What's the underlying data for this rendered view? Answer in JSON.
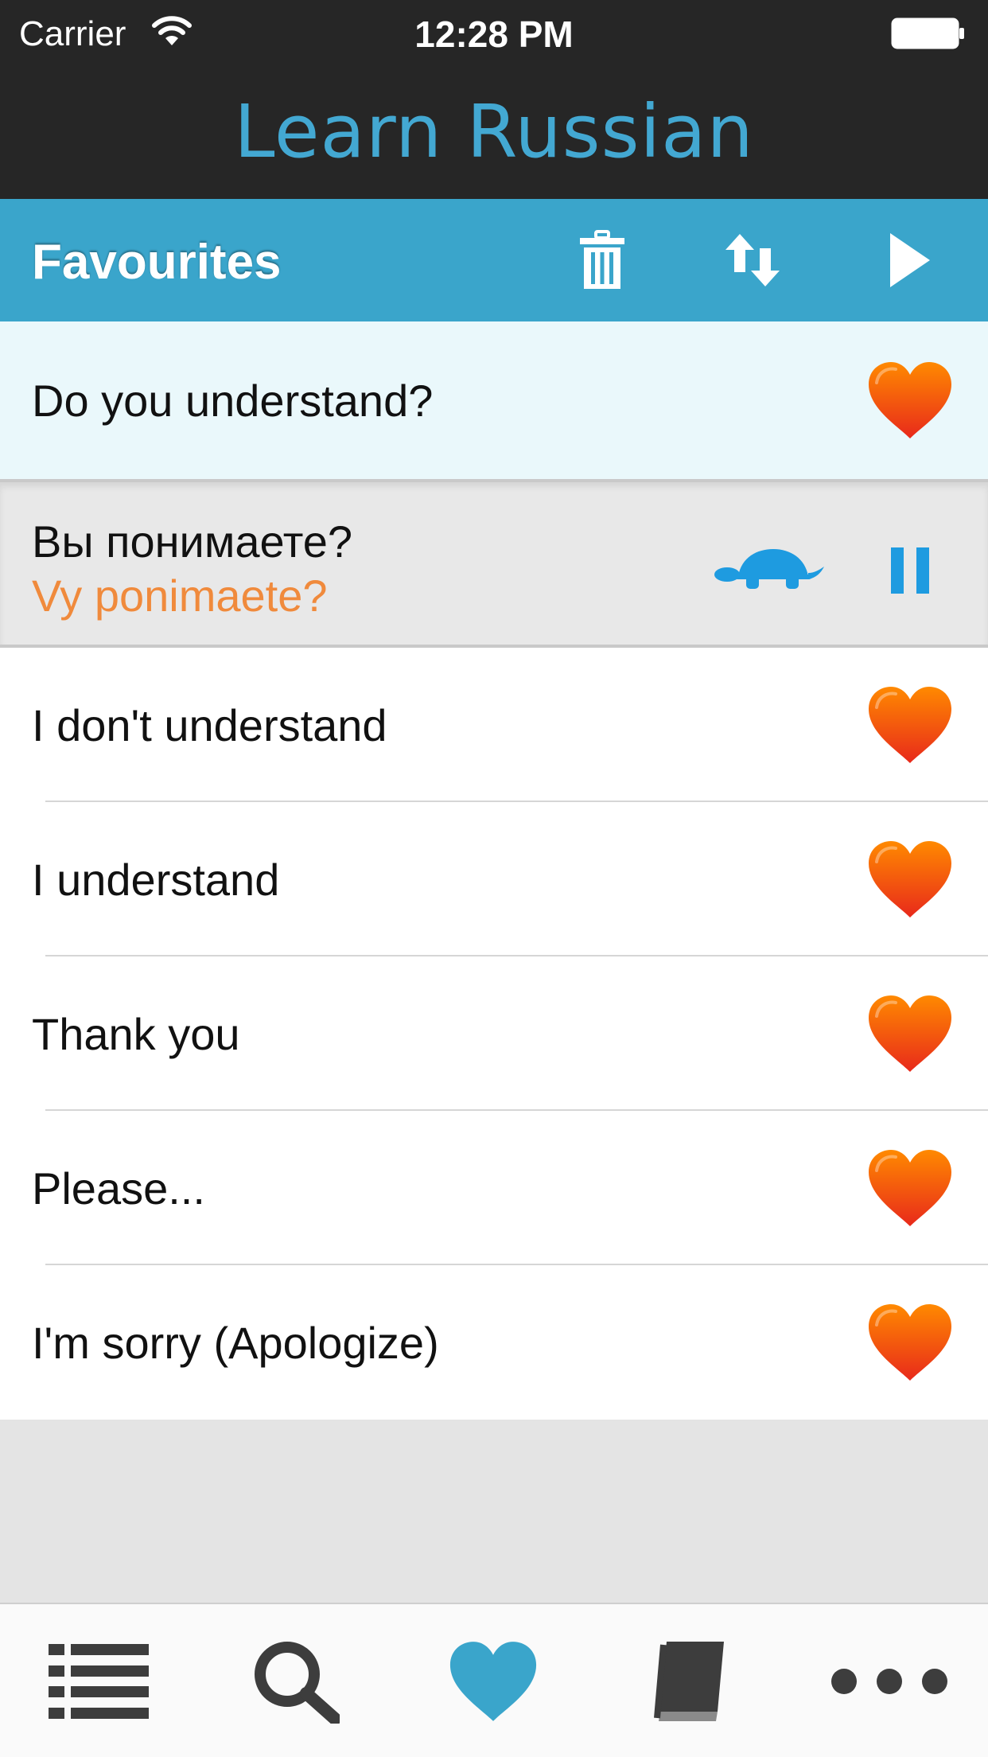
{
  "status_bar": {
    "carrier": "Carrier",
    "time": "12:28 PM"
  },
  "nav": {
    "title": "Learn Russian"
  },
  "section": {
    "label": "Favourites",
    "actions": [
      "trash-icon",
      "sort-icon",
      "play-icon"
    ]
  },
  "selected_phrase": {
    "english": "Do you understand?",
    "native": "Вы понимаете?",
    "transliteration": "Vy ponimaete?"
  },
  "phrases": [
    {
      "english": "I don't understand"
    },
    {
      "english": "I understand"
    },
    {
      "english": "Thank you"
    },
    {
      "english": "Please..."
    },
    {
      "english": "I'm sorry (Apologize)"
    }
  ],
  "tabs": [
    "list-icon",
    "search-icon",
    "heart-icon",
    "book-icon",
    "more-icon"
  ],
  "colors": {
    "accent": "#3aa5cb",
    "title": "#43a8d2",
    "transliteration": "#f08a3c",
    "heart_top": "#ff8a00",
    "heart_bottom": "#e8291b",
    "selected_row": "#eaf8fb"
  }
}
